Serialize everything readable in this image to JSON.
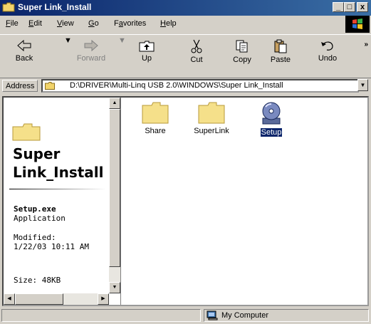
{
  "window": {
    "title": "Super Link_Install"
  },
  "title_buttons": {
    "minimize": "_",
    "maximize": "□",
    "close": "x"
  },
  "menu": [
    {
      "label": "File",
      "key": "F",
      "rest": "ile"
    },
    {
      "label": "Edit",
      "key": "E",
      "rest": "dit"
    },
    {
      "label": "View",
      "key": "V",
      "rest": "iew"
    },
    {
      "label": "Go",
      "key": "G",
      "rest": "o"
    },
    {
      "label": "Favorites",
      "key": "a",
      "pre": "F",
      "rest": "vorites"
    },
    {
      "label": "Help",
      "key": "H",
      "rest": "elp"
    }
  ],
  "toolbar": {
    "back": "Back",
    "forward": "Forward",
    "up": "Up",
    "cut": "Cut",
    "copy": "Copy",
    "paste": "Paste",
    "undo": "Undo",
    "more": "»"
  },
  "address": {
    "label": "Address",
    "label_key": "d",
    "value": "D:\\DRIVER\\Multi-Linq USB 2.0\\WINDOWS\\Super Link_Install"
  },
  "left_pane": {
    "title_line1": "Super",
    "title_line2": "Link_Install",
    "file_name": "Setup.exe",
    "file_type": "Application",
    "modified_label": "Modified:",
    "modified_value": "1/22/03 10:11 AM",
    "size": "Size: 48KB"
  },
  "files": [
    {
      "name": "Share",
      "icon": "folder-icon",
      "selected": false
    },
    {
      "name": "SuperLink",
      "icon": "folder-icon",
      "selected": false
    },
    {
      "name": "Setup",
      "icon": "setup-cd-icon",
      "selected": true
    }
  ],
  "status": {
    "location": "My Computer"
  },
  "colors": {
    "titlebar": "#0a246a",
    "selection": "#0a246a",
    "chrome": "#d4d0c8"
  }
}
